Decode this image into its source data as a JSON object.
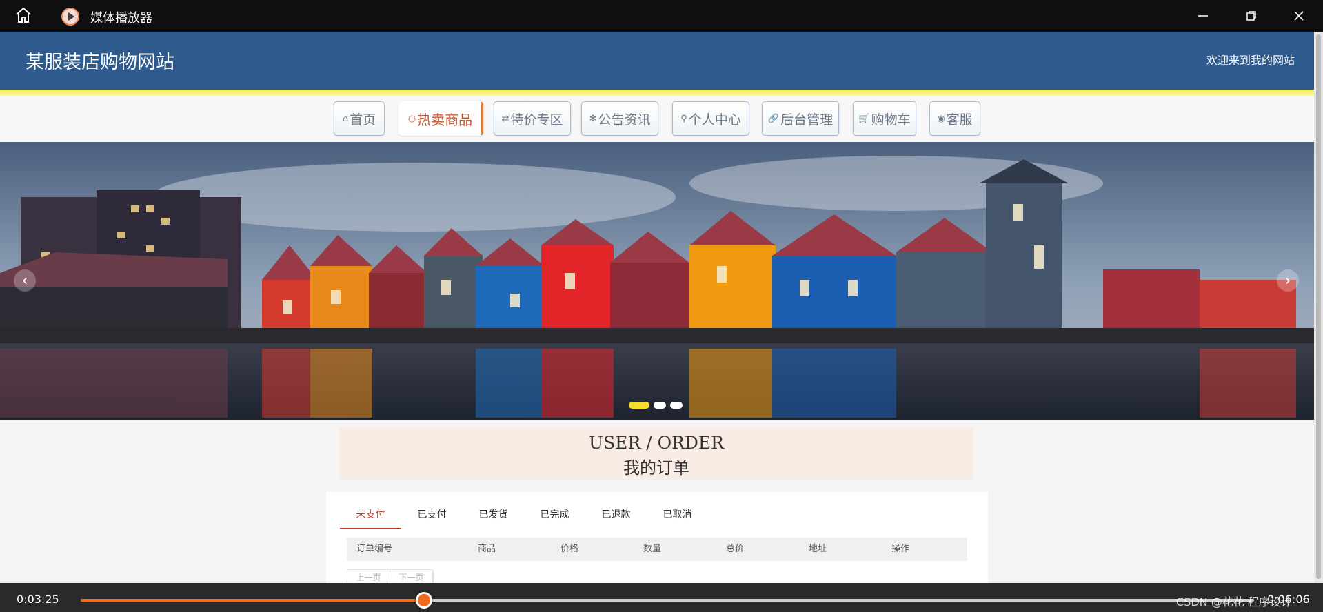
{
  "player": {
    "title": "媒体播放器",
    "current_time": "0:03:25",
    "total_time": "0:06:06",
    "progress": 0.2925,
    "watermark": "CSDN @花花 程序设计",
    "icons": [
      "home-icon",
      "play-circle-icon",
      "minimize-icon",
      "maximize-icon",
      "close-icon"
    ]
  },
  "site": {
    "logo": "某服装店购物网站",
    "welcome": "欢迎来到我的网站",
    "nav": [
      {
        "icon": "⌂",
        "label": "首页"
      },
      {
        "icon": "◷",
        "label": "热卖商品"
      },
      {
        "icon": "⇄",
        "label": "特价专区"
      },
      {
        "icon": "✻",
        "label": "公告资讯"
      },
      {
        "icon": "♀",
        "label": "个人中心"
      },
      {
        "icon": "🔗",
        "label": "后台管理"
      },
      {
        "icon": "🛒",
        "label": "购物车"
      },
      {
        "icon": "◉",
        "label": "客服"
      }
    ],
    "nav_active": 1,
    "banner": {
      "prev": "‹",
      "next": "›",
      "slides": 3,
      "active_slide": 0
    }
  },
  "order": {
    "title_en": "USER / ORDER",
    "title_cn": "我的订单",
    "tabs": [
      "未支付",
      "已支付",
      "已发货",
      "已完成",
      "已退款",
      "已取消"
    ],
    "active_tab": 0,
    "columns": [
      "订单编号",
      "商品",
      "价格",
      "数量",
      "总价",
      "地址",
      "操作"
    ],
    "pager": [
      "上一页",
      "下一页"
    ]
  },
  "colors": {
    "header": "#2e5a8e",
    "accent_yellow": "#f5dd2c",
    "progress": "#f26a1f",
    "active_tab": "#c0392b"
  }
}
